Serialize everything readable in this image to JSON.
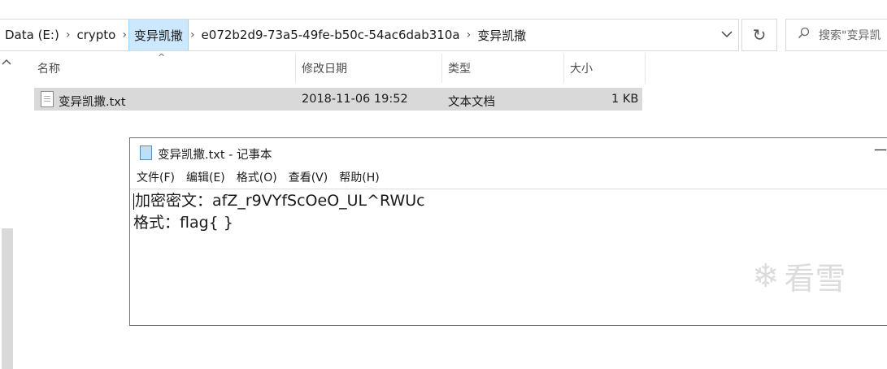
{
  "breadcrumb": [
    "Data (E:)",
    "crypto",
    "变异凯撒",
    "e072b2d9-73a5-49fe-b50c-54ac6dab310a",
    "变异凯撒"
  ],
  "search": {
    "placeholder": "搜索\"变异凯"
  },
  "columns": {
    "name": "名称",
    "modified": "修改日期",
    "type": "类型",
    "size": "大小"
  },
  "file": {
    "name": "变异凯撒.txt",
    "modified": "2018-11-06 19:52",
    "type": "文本文档",
    "size": "1 KB"
  },
  "notepad": {
    "title": "变异凯撒.txt - 记事本",
    "menu": [
      "文件(F)",
      "编辑(E)",
      "格式(O)",
      "查看(V)",
      "帮助(H)"
    ],
    "lines": [
      "加密密文：afZ_r9VYfScOeO_UL^RWUc",
      "格式：flag{ }"
    ],
    "minimize": "—"
  },
  "watermark": {
    "text": "看雪",
    "icon": "snowflake-icon"
  },
  "colors": {
    "selected_crumb": "#cce8ff",
    "selected_row": "#d9d9d9"
  }
}
